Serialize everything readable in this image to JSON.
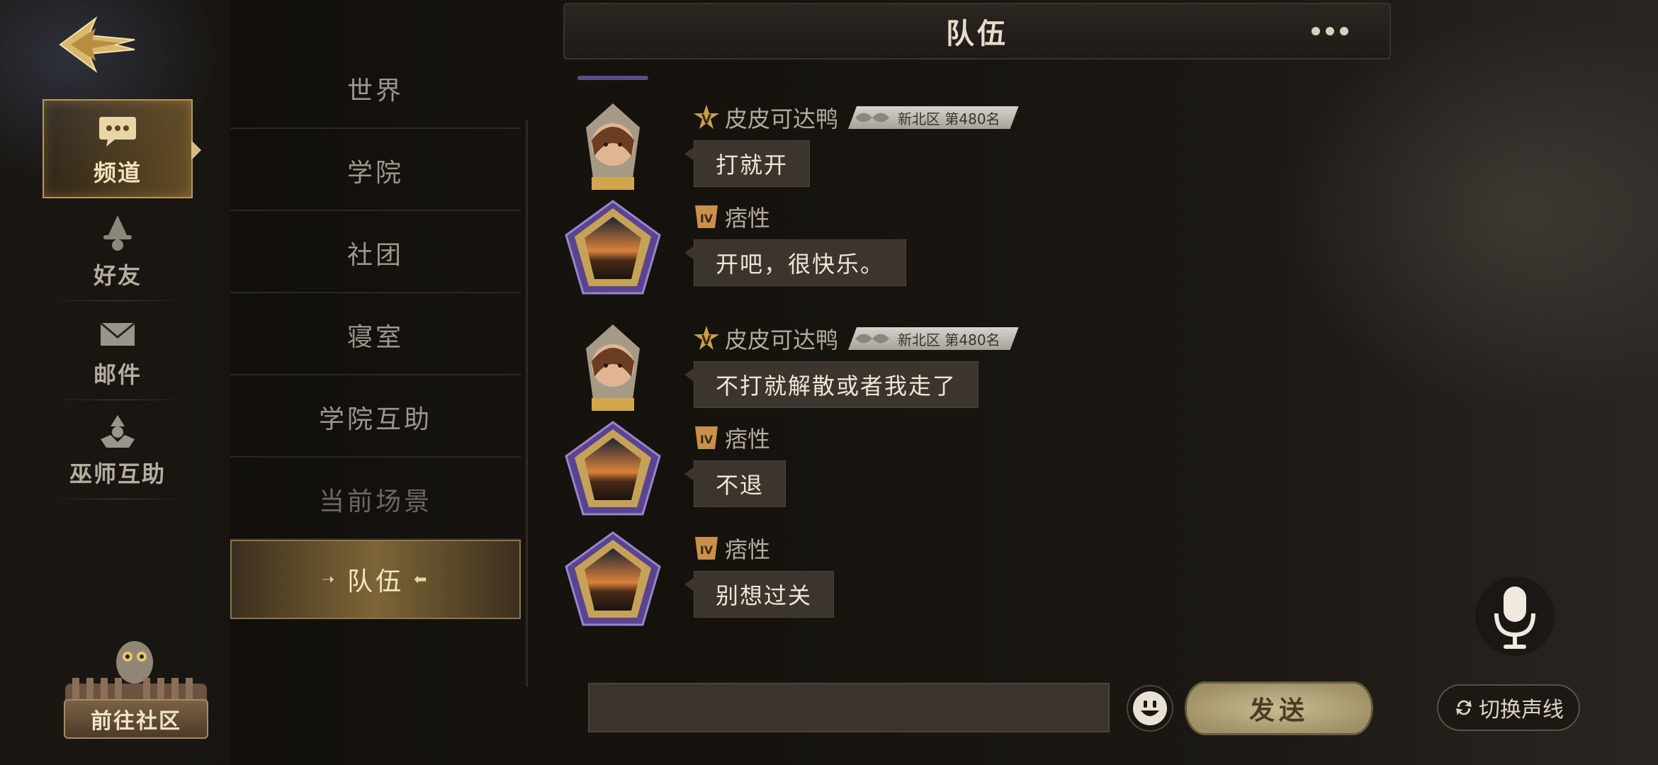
{
  "nav": {
    "items": [
      {
        "label": "频道",
        "icon": "chat-bubble-icon",
        "active": true
      },
      {
        "label": "好友",
        "icon": "wizard-hat-icon",
        "active": false
      },
      {
        "label": "邮件",
        "icon": "envelope-icon",
        "active": false
      },
      {
        "label": "巫师互助",
        "icon": "wizard-help-icon",
        "active": false
      }
    ],
    "community_label": "前往社区"
  },
  "channels": [
    {
      "label": "世界"
    },
    {
      "label": "学院"
    },
    {
      "label": "社团"
    },
    {
      "label": "寝室"
    },
    {
      "label": "学院互助"
    },
    {
      "label": "当前场景"
    },
    {
      "label": "队伍",
      "active": true
    }
  ],
  "chat": {
    "title": "队伍",
    "messages": [
      {
        "sender": "皮皮可达鸭",
        "rank_badge": "新北区 第480名",
        "text": "打就开",
        "avatar": "student-portrait"
      },
      {
        "sender": "痞性",
        "rank_badge": "",
        "text": "开吧，很快乐。",
        "avatar": "sunset-card-frame"
      },
      {
        "sender": "皮皮可达鸭",
        "rank_badge": "新北区 第480名",
        "text": "不打就解散或者我走了",
        "avatar": "student-portrait"
      },
      {
        "sender": "痞性",
        "rank_badge": "",
        "text": "不退",
        "avatar": "sunset-card-frame"
      },
      {
        "sender": "痞性",
        "rank_badge": "",
        "text": "别想过关",
        "avatar": "sunset-card-frame"
      }
    ]
  },
  "input": {
    "value": "",
    "placeholder": ""
  },
  "send_label": "发送",
  "voice_switch_label": "切换声线",
  "colors": {
    "accent_gold": "#c9a965",
    "bubble": "#3b352d",
    "frame_purple": "#6b4fa0"
  }
}
